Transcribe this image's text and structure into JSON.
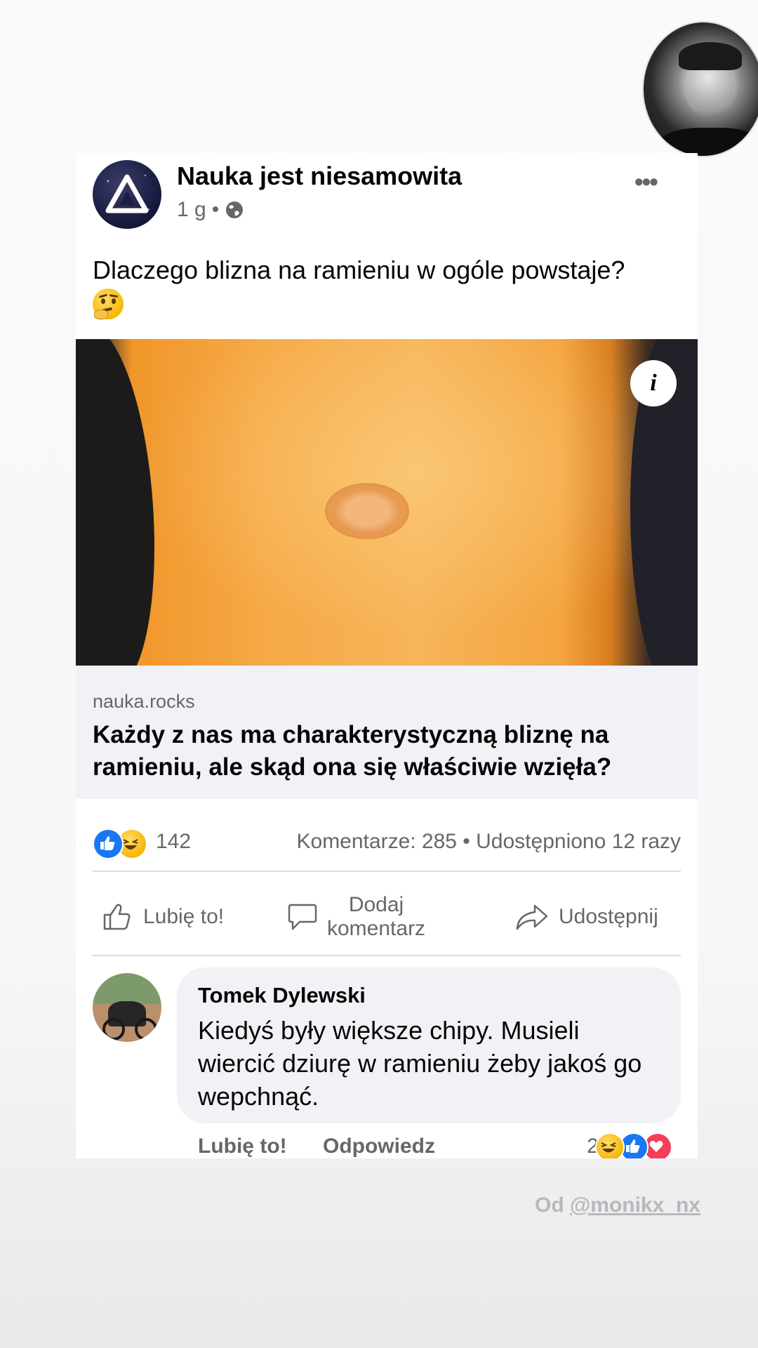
{
  "story": {
    "avatar_icon": "profile-photo"
  },
  "post": {
    "page_name": "Nauka jest niesamowita",
    "time": "1 g",
    "separator": "•",
    "privacy_icon": "globe-icon",
    "more_label": "•••",
    "text": "Dlaczego blizna na ramieniu w ogóle powstaje?",
    "info_label": "i"
  },
  "link": {
    "domain": "nauka.rocks",
    "title": "Każdy z nas ma charakterystyczną bliznę na ramieniu, ale skąd ona się właściwie wzięła?"
  },
  "stats": {
    "reaction_count": "142",
    "comments_shares": "Komentarze: 285 • Udostępniono 12 razy"
  },
  "actions": {
    "like": "Lubię to!",
    "comment_line1": "Dodaj",
    "comment_line2": "komentarz",
    "share": "Udostępnij"
  },
  "comment": {
    "author": "Tomek Dylewski",
    "text": "Kiedyś były większe chipy. Musieli wiercić dziurę w ramieniu żeby jakoś go wepchnąć.",
    "like": "Lubię to!",
    "reply": "Odpowiedz",
    "reaction_count": "211"
  },
  "credit": {
    "prefix": "Od ",
    "handle": "@monikx_nx"
  },
  "colors": {
    "facebook_blue": "#1877f2",
    "love_red": "#f33e58",
    "muted": "#65676b",
    "link_bg": "#f0f2f5"
  }
}
